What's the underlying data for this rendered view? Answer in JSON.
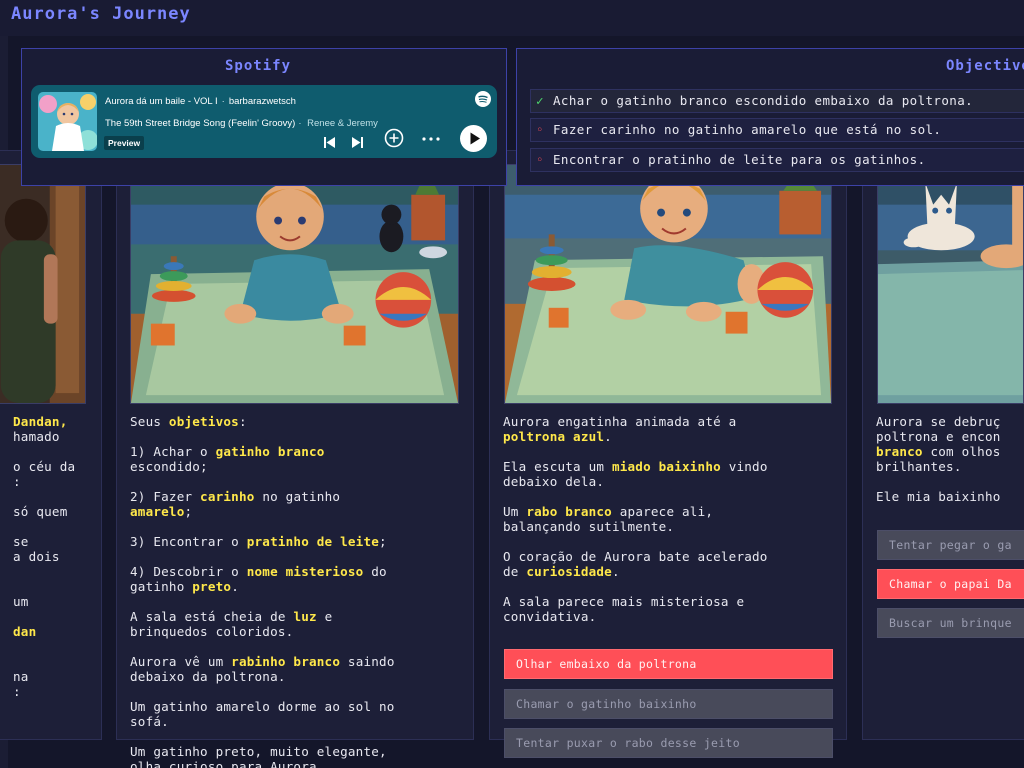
{
  "app": {
    "title": "Aurora's Journey"
  },
  "spotify": {
    "panel_title": "Spotify",
    "album": "Aurora dá um baile - VOL I",
    "owner": "barbarazwetsch",
    "song": "The 59th Street Bridge Song (Feelin' Groovy)",
    "artist": "Renee & Jeremy",
    "badge": "Preview",
    "icons": [
      "spotify-logo-icon",
      "previous-icon",
      "next-icon",
      "add-icon",
      "more-icon",
      "play-icon"
    ],
    "colors": {
      "card": "#0f5c6e"
    }
  },
  "objectives": {
    "panel_title": "Objectives",
    "items": [
      {
        "text": "Achar o gatinho branco escondido embaixo da poltrona.",
        "done": true
      },
      {
        "text": "Fazer carinho no gatinho amarelo que está no sol.",
        "done": false
      },
      {
        "text": "Encontrar o pratinho de leite para os gatinhos.",
        "done": false
      }
    ]
  },
  "columns": [
    {
      "text_lines": [
        [
          [
            "Dandan,",
            true
          ]
        ],
        [
          [
            "hamado",
            false
          ]
        ],
        [
          [
            "",
            false
          ]
        ],
        [
          [
            "o céu da",
            false
          ]
        ],
        [
          [
            ":",
            false
          ]
        ],
        [
          [
            "",
            false
          ]
        ],
        [
          [
            "só quem",
            false
          ]
        ],
        [
          [
            "",
            false
          ]
        ],
        [
          [
            "se",
            false
          ]
        ],
        [
          [
            "a dois",
            false
          ]
        ],
        [
          [
            "",
            false
          ]
        ],
        [
          [
            "",
            false
          ]
        ],
        [
          [
            "um",
            false
          ]
        ],
        [
          [
            "",
            false
          ]
        ],
        [
          [
            "dan",
            true
          ]
        ],
        [
          [
            "",
            false
          ]
        ],
        [
          [
            "",
            false
          ]
        ],
        [
          [
            "na",
            false
          ]
        ],
        [
          [
            ":",
            false
          ]
        ]
      ]
    },
    {
      "text_lines": [
        [
          [
            "Seus ",
            false
          ],
          [
            "objetivos",
            true
          ],
          [
            ":",
            false
          ]
        ],
        [
          [
            "",
            false
          ]
        ],
        [
          [
            "1) Achar o ",
            false
          ],
          [
            "gatinho branco",
            true
          ]
        ],
        [
          [
            "escondido;",
            false
          ]
        ],
        [
          [
            "",
            false
          ]
        ],
        [
          [
            "2) Fazer ",
            false
          ],
          [
            "carinho",
            true
          ],
          [
            " no gatinho",
            false
          ]
        ],
        [
          [
            "amarelo",
            true
          ],
          [
            ";",
            false
          ]
        ],
        [
          [
            "",
            false
          ]
        ],
        [
          [
            "3) Encontrar o ",
            false
          ],
          [
            "pratinho de leite",
            true
          ],
          [
            ";",
            false
          ]
        ],
        [
          [
            "",
            false
          ]
        ],
        [
          [
            "4) Descobrir o ",
            false
          ],
          [
            "nome misterioso",
            true
          ],
          [
            " do",
            false
          ]
        ],
        [
          [
            "gatinho ",
            false
          ],
          [
            "preto",
            true
          ],
          [
            ".",
            false
          ]
        ],
        [
          [
            "",
            false
          ]
        ],
        [
          [
            "A sala está cheia de ",
            false
          ],
          [
            "luz",
            true
          ],
          [
            " e",
            false
          ]
        ],
        [
          [
            "brinquedos coloridos.",
            false
          ]
        ],
        [
          [
            "",
            false
          ]
        ],
        [
          [
            "Aurora vê um ",
            false
          ],
          [
            "rabinho branco",
            true
          ],
          [
            " saindo",
            false
          ]
        ],
        [
          [
            "debaixo da poltrona.",
            false
          ]
        ],
        [
          [
            "",
            false
          ]
        ],
        [
          [
            "Um gatinho amarelo dorme ao sol no",
            false
          ]
        ],
        [
          [
            "sofá.",
            false
          ]
        ],
        [
          [
            "",
            false
          ]
        ],
        [
          [
            "Um gatinho preto, muito elegante,",
            false
          ]
        ],
        [
          [
            "olha curioso para Aurora.",
            false
          ]
        ]
      ]
    },
    {
      "text_lines": [
        [
          [
            "Aurora engatinha animada até a",
            false
          ]
        ],
        [
          [
            "poltrona azul",
            true
          ],
          [
            ".",
            false
          ]
        ],
        [
          [
            "",
            false
          ]
        ],
        [
          [
            "Ela escuta um ",
            false
          ],
          [
            "miado baixinho",
            true
          ],
          [
            " vindo",
            false
          ]
        ],
        [
          [
            "debaixo dela.",
            false
          ]
        ],
        [
          [
            "",
            false
          ]
        ],
        [
          [
            "Um ",
            false
          ],
          [
            "rabo branco",
            true
          ],
          [
            " aparece ali,",
            false
          ]
        ],
        [
          [
            "balançando sutilmente.",
            false
          ]
        ],
        [
          [
            "",
            false
          ]
        ],
        [
          [
            "O coração de Aurora bate acelerado",
            false
          ]
        ],
        [
          [
            "de ",
            false
          ],
          [
            "curiosidade",
            true
          ],
          [
            ".",
            false
          ]
        ],
        [
          [
            "",
            false
          ]
        ],
        [
          [
            "A sala parece mais misteriosa e",
            false
          ]
        ],
        [
          [
            "convidativa.",
            false
          ]
        ]
      ],
      "choices": [
        {
          "label": "Olhar embaixo da poltrona",
          "primary": true
        },
        {
          "label": "Chamar o gatinho baixinho",
          "primary": false
        },
        {
          "label": "Tentar puxar o rabo desse jeito",
          "primary": false
        }
      ]
    },
    {
      "text_lines": [
        [
          [
            "Aurora se debruç",
            false
          ]
        ],
        [
          [
            "poltrona e encon",
            false
          ]
        ],
        [
          [
            "branco",
            true
          ],
          [
            " com olhos",
            false
          ]
        ],
        [
          [
            "brilhantes.",
            false
          ]
        ],
        [
          [
            "",
            false
          ]
        ],
        [
          [
            "Ele mia baixinho",
            false
          ]
        ]
      ],
      "choices": [
        {
          "label": "Tentar pegar o ga",
          "primary": false
        },
        {
          "label": "Chamar o papai Da",
          "primary": true
        },
        {
          "label": "Buscar um brinque",
          "primary": false
        }
      ]
    }
  ],
  "colors": {
    "accent": "#7b86ff",
    "highlight": "#ffe84a",
    "primary_button": "#ff4f57",
    "secondary_button": "#484a5a",
    "check": "#4cd36b"
  }
}
